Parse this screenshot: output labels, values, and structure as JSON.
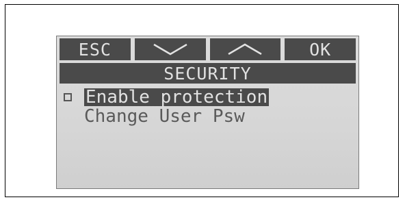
{
  "softkeys": {
    "esc_label": "ESC",
    "down_icon": "chevron-down-icon",
    "up_icon": "chevron-up-icon",
    "ok_label": "OK"
  },
  "screen": {
    "title": "SECURITY"
  },
  "menu": {
    "items": [
      {
        "label": "Enable protection",
        "checked": false,
        "selected": true
      },
      {
        "label": "Change User Psw",
        "selected": false
      }
    ]
  },
  "colors": {
    "lcd_background": "#d8d8d8",
    "bar_background": "#4a4a4a",
    "bar_text": "#e2e2e2",
    "text": "#5a5a5a"
  }
}
